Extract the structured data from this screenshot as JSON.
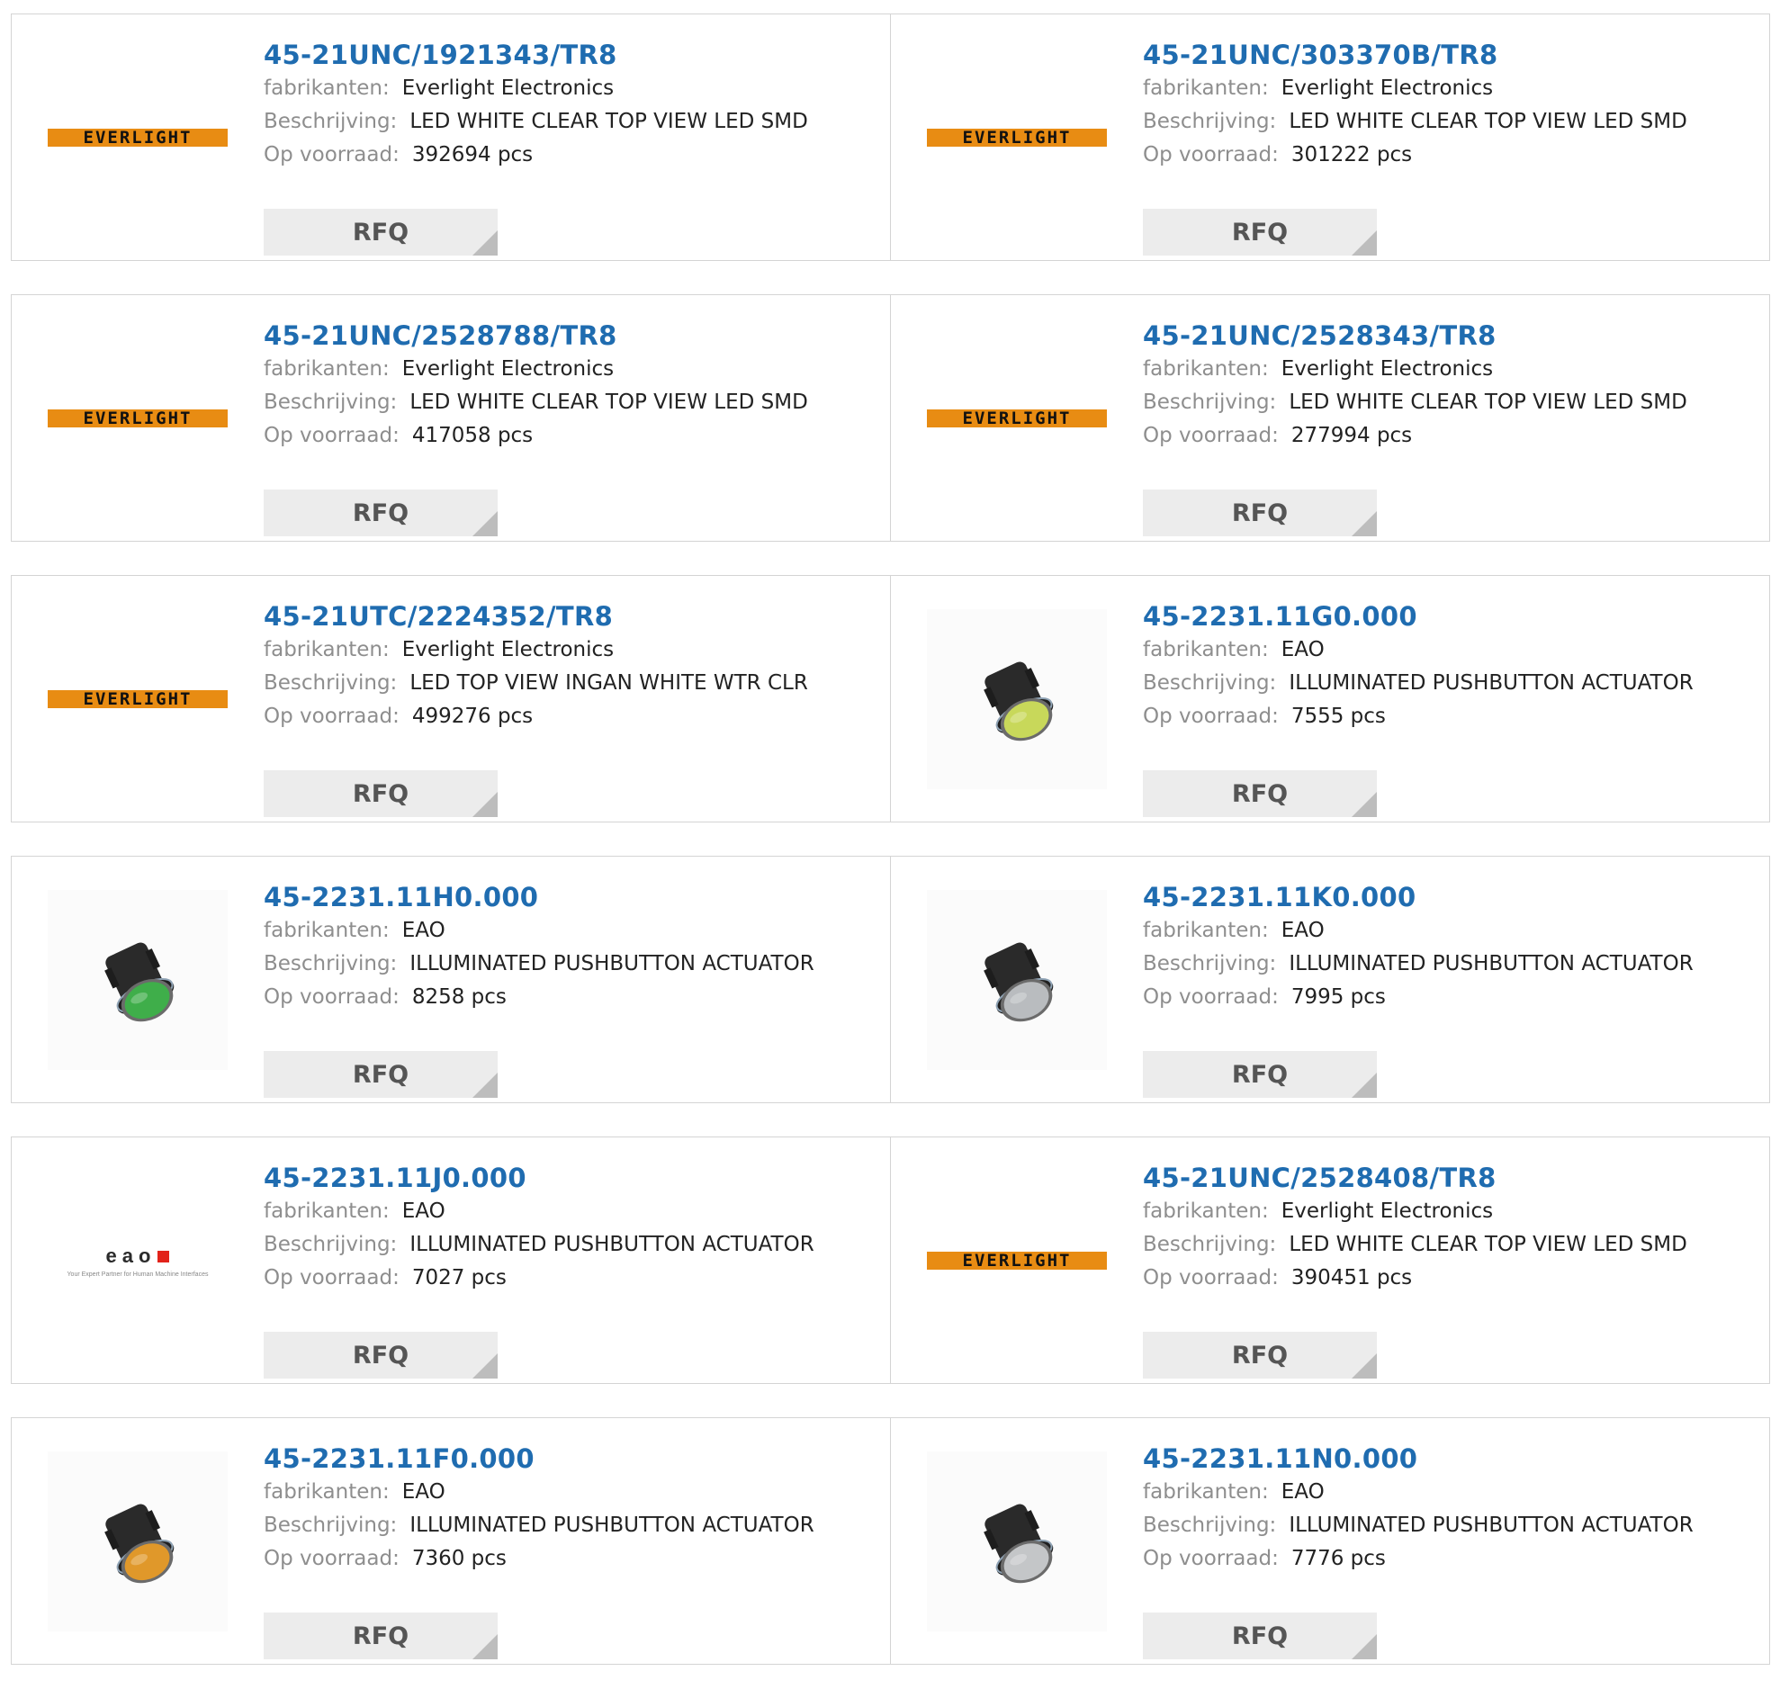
{
  "labels": {
    "manufacturer": "fabrikanten:",
    "description": "Beschrijving:",
    "stock": "Op voorraad:",
    "rfq": "RFQ"
  },
  "products": [
    {
      "part": "45-21UNC/1921343/TR8",
      "manufacturer": "Everlight Electronics",
      "description": "LED WHITE CLEAR TOP VIEW LED SMD",
      "stock": "392694 pcs",
      "image": "everlight-logo"
    },
    {
      "part": "45-21UNC/303370B/TR8",
      "manufacturer": "Everlight Electronics",
      "description": "LED WHITE CLEAR TOP VIEW LED SMD",
      "stock": "301222 pcs",
      "image": "everlight-logo"
    },
    {
      "part": "45-21UNC/2528788/TR8",
      "manufacturer": "Everlight Electronics",
      "description": "LED WHITE CLEAR TOP VIEW LED SMD",
      "stock": "417058 pcs",
      "image": "everlight-logo"
    },
    {
      "part": "45-21UNC/2528343/TR8",
      "manufacturer": "Everlight Electronics",
      "description": "LED WHITE CLEAR TOP VIEW LED SMD",
      "stock": "277994 pcs",
      "image": "everlight-logo"
    },
    {
      "part": "45-21UTC/2224352/TR8",
      "manufacturer": "Everlight Electronics",
      "description": "LED TOP VIEW INGAN WHITE WTR CLR",
      "stock": "499276 pcs",
      "image": "everlight-logo"
    },
    {
      "part": "45-2231.11G0.000",
      "manufacturer": "EAO",
      "description": "ILLUMINATED PUSHBUTTON ACTUATOR",
      "stock": "7555 pcs",
      "image": "pushbutton-photo",
      "lens_color": "#c8d85a"
    },
    {
      "part": "45-2231.11H0.000",
      "manufacturer": "EAO",
      "description": "ILLUMINATED PUSHBUTTON ACTUATOR",
      "stock": "8258 pcs",
      "image": "pushbutton-photo",
      "lens_color": "#3fae4a"
    },
    {
      "part": "45-2231.11K0.000",
      "manufacturer": "EAO",
      "description": "ILLUMINATED PUSHBUTTON ACTUATOR",
      "stock": "7995 pcs",
      "image": "pushbutton-photo",
      "lens_color": "#b9bcbf"
    },
    {
      "part": "45-2231.11J0.000",
      "manufacturer": "EAO",
      "description": "ILLUMINATED PUSHBUTTON ACTUATOR",
      "stock": "7027 pcs",
      "image": "eao-logo"
    },
    {
      "part": "45-21UNC/2528408/TR8",
      "manufacturer": "Everlight Electronics",
      "description": "LED WHITE CLEAR TOP VIEW LED SMD",
      "stock": "390451 pcs",
      "image": "everlight-logo"
    },
    {
      "part": "45-2231.11F0.000",
      "manufacturer": "EAO",
      "description": "ILLUMINATED PUSHBUTTON ACTUATOR",
      "stock": "7360 pcs",
      "image": "pushbutton-photo",
      "lens_color": "#e0982a"
    },
    {
      "part": "45-2231.11N0.000",
      "manufacturer": "EAO",
      "description": "ILLUMINATED PUSHBUTTON ACTUATOR",
      "stock": "7776 pcs",
      "image": "pushbutton-photo",
      "lens_color": "#c4c6c8"
    }
  ],
  "logos": {
    "everlight_text": "EVERLIGHT",
    "eao_text": "eao",
    "eao_tagline": "Your Expert Partner for Human Machine Interfaces"
  },
  "colors": {
    "link": "#1f6cb0",
    "label": "#8e8e8e",
    "everlight_orange": "#e88c13",
    "eao_red": "#e2231a",
    "button_bg": "#ececec"
  }
}
